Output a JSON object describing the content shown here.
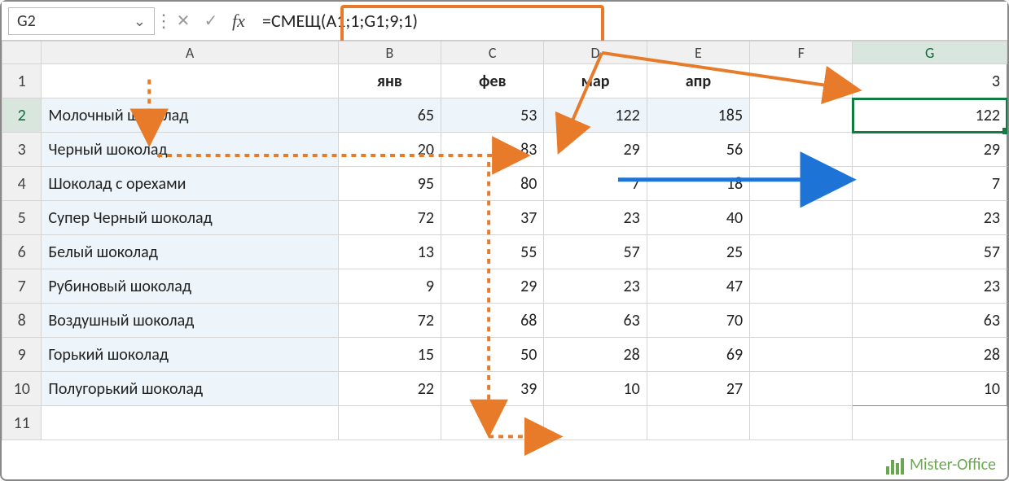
{
  "nameBox": "G2",
  "formula": "=СМЕЩ(A1;1;G1;9;1)",
  "columns": [
    "A",
    "B",
    "C",
    "D",
    "E",
    "F",
    "G"
  ],
  "headerRow": {
    "A": "",
    "B": "янв",
    "C": "фев",
    "D": "мар",
    "E": "апр",
    "F": "",
    "G": "3"
  },
  "rows": [
    {
      "n": 2,
      "A": "Молочный шоколад",
      "B": 65,
      "C": 53,
      "D": 122,
      "E": 185,
      "F": "",
      "G": 122
    },
    {
      "n": 3,
      "A": "Черный шоколад",
      "B": 20,
      "C": 83,
      "D": 29,
      "E": 56,
      "F": "",
      "G": 29
    },
    {
      "n": 4,
      "A": "Шоколад с орехами",
      "B": 95,
      "C": 80,
      "D": 7,
      "E": 18,
      "F": "",
      "G": 7
    },
    {
      "n": 5,
      "A": "Супер Черный шоколад",
      "B": 72,
      "C": 37,
      "D": 23,
      "E": 40,
      "F": "",
      "G": 23
    },
    {
      "n": 6,
      "A": "Белый шоколад",
      "B": 13,
      "C": 55,
      "D": 57,
      "E": 25,
      "F": "",
      "G": 57
    },
    {
      "n": 7,
      "A": "Рубиновый шоколад",
      "B": 9,
      "C": 29,
      "D": 23,
      "E": 47,
      "F": "",
      "G": 23
    },
    {
      "n": 8,
      "A": "Воздушный шоколад",
      "B": 72,
      "C": 68,
      "D": 63,
      "E": 70,
      "F": "",
      "G": 63
    },
    {
      "n": 9,
      "A": "Горький шоколад",
      "B": 15,
      "C": 50,
      "D": 28,
      "E": 69,
      "F": "",
      "G": 28
    },
    {
      "n": 10,
      "A": "Полугорький шоколад",
      "B": 22,
      "C": 39,
      "D": 10,
      "E": 27,
      "F": "",
      "G": 10
    }
  ],
  "watermark": "Mister-Office",
  "icons": {
    "cancel": "✕",
    "enter": "✓",
    "fx": "fx",
    "chev": "⌄"
  }
}
